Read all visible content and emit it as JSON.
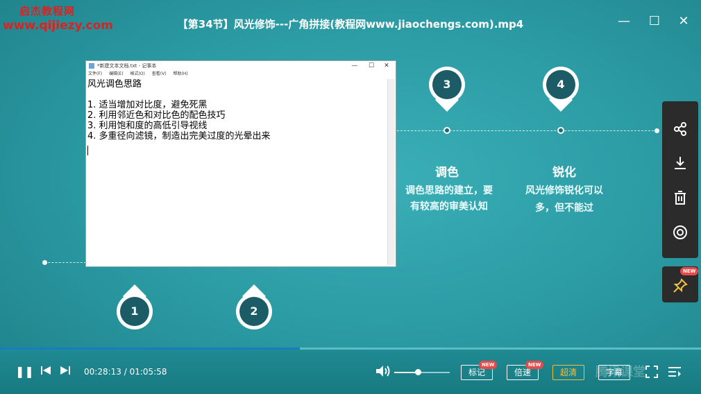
{
  "watermark": {
    "line1": "启杰教程网",
    "line2": "www.qijiezy.com"
  },
  "window": {
    "title": "【第34节】风光修饰---广角拼接(教程网www.jiaochengs.com).mp4",
    "minimize": "—",
    "maximize": "☐",
    "close": "✕"
  },
  "timeline": {
    "steps": [
      {
        "num": "1"
      },
      {
        "num": "2"
      },
      {
        "num": "3",
        "title": "调色",
        "desc1": "调色思路的建立，要",
        "desc2": "有较高的审美认知"
      },
      {
        "num": "4",
        "title": "锐化",
        "desc1": "风光修饰锐化可以",
        "desc2": "多，但不能过"
      }
    ]
  },
  "notepad": {
    "title": "*新建文本文档.txt - 记事本",
    "menu": [
      "文件(F)",
      "编辑(E)",
      "格式(O)",
      "查看(V)",
      "帮助(H)"
    ],
    "controls": {
      "min": "—",
      "max": "☐",
      "close": "✕"
    },
    "lines": [
      "风光调色思路",
      "",
      "1. 适当增加对比度，避免死黑",
      "2. 利用邻近色和对比色的配色技巧",
      "3. 利用饱和度的高低引导视线",
      "4. 多重径向滤镜，制造出完美过度的光晕出来"
    ]
  },
  "side_panel": {
    "icons": [
      "share-icon",
      "download-icon",
      "trash-icon",
      "record-icon"
    ],
    "pin_badge": "NEW"
  },
  "player": {
    "progress": 0.428,
    "time": "00:28:13 / 01:05:58",
    "volume": 0.42,
    "buttons": {
      "mark": "标记",
      "mark_badge": "NEW",
      "speed": "倍速",
      "speed_badge": "NEW",
      "quality": "超清",
      "subtitle": "字幕"
    },
    "brand": "腾讯课堂"
  }
}
